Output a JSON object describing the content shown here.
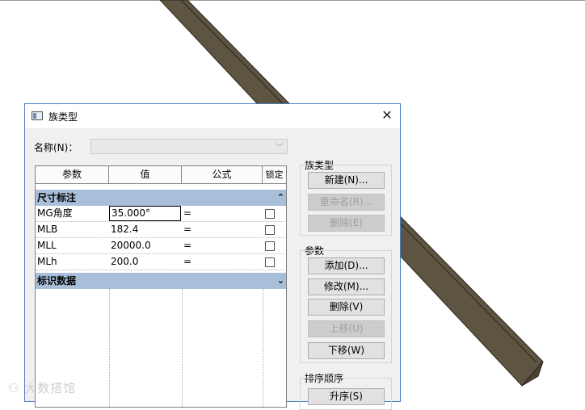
{
  "dialog": {
    "title": "族类型",
    "close_glyph": "✕",
    "name_label": "名称(N)：",
    "name_value": ""
  },
  "table": {
    "headers": [
      "参数",
      "值",
      "公式",
      "锁定"
    ],
    "groups": [
      {
        "label": "尺寸标注",
        "arrow": "⌃"
      },
      {
        "label": "标识数据",
        "arrow": "⌄"
      }
    ],
    "rows": [
      {
        "param": "MG角度",
        "value": "35.000°",
        "formula": "="
      },
      {
        "param": "MLB",
        "value": "182.4",
        "formula": "="
      },
      {
        "param": "MLL",
        "value": "20000.0",
        "formula": "="
      },
      {
        "param": "MLh",
        "value": "200.0",
        "formula": "="
      }
    ]
  },
  "side": {
    "family_types_title": "族类型",
    "new": "新建(N)...",
    "rename": "重命名(R)...",
    "delete_type": "删除(E)",
    "params_title": "参数",
    "add": "添加(D)...",
    "modify": "修改(M)...",
    "remove": "删除(V)",
    "move_up": "上移(U)",
    "move_down": "下移(W)",
    "sort_title": "排序顺序",
    "ascending": "升序(S)"
  },
  "watermark": "⚇ 大数搭馆",
  "colors": {
    "beam_face": "#5e5442",
    "beam_edge": "#2c2618",
    "group_header": "#a9bed8",
    "dialog_border": "#4a7fc1"
  }
}
